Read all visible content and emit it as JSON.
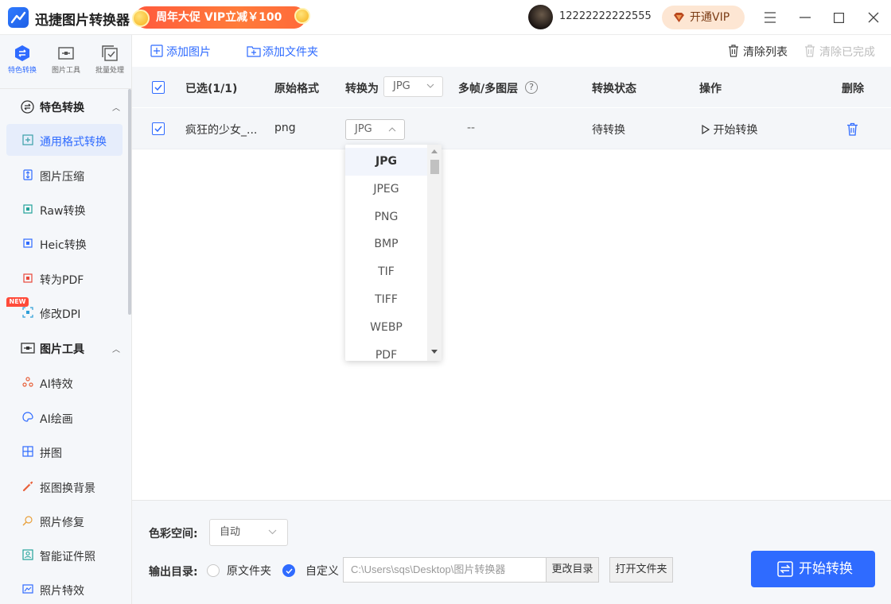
{
  "app": {
    "title": "迅捷图片转换器",
    "promo": "周年大促 VIP立减￥100",
    "user_phone": "12222222222555",
    "vip_label": "开通VIP"
  },
  "sidebar": {
    "tabs": [
      {
        "label": "特色转换",
        "icon": "special-convert-icon",
        "active": true
      },
      {
        "label": "图片工具",
        "icon": "image-tools-icon",
        "active": false
      },
      {
        "label": "批量处理",
        "icon": "batch-process-icon",
        "active": false
      }
    ],
    "groups": [
      {
        "label": "特色转换",
        "icon": "special-convert-icon",
        "items": [
          {
            "label": "通用格式转换",
            "icon": "format-convert-icon",
            "active": true
          },
          {
            "label": "图片压缩",
            "icon": "compress-icon"
          },
          {
            "label": "Raw转换",
            "icon": "raw-icon"
          },
          {
            "label": "Heic转换",
            "icon": "heic-icon"
          },
          {
            "label": "转为PDF",
            "icon": "pdf-icon"
          },
          {
            "label": "修改DPI",
            "icon": "dpi-icon",
            "badge": "NEW"
          }
        ]
      },
      {
        "label": "图片工具",
        "icon": "image-tools-icon",
        "items": [
          {
            "label": "AI特效",
            "icon": "ai-effect-icon"
          },
          {
            "label": "AI绘画",
            "icon": "ai-paint-icon"
          },
          {
            "label": "拼图",
            "icon": "collage-icon"
          },
          {
            "label": "抠图换背景",
            "icon": "cutout-icon"
          },
          {
            "label": "照片修复",
            "icon": "photo-repair-icon"
          },
          {
            "label": "智能证件照",
            "icon": "id-photo-icon"
          },
          {
            "label": "照片特效",
            "icon": "photo-effect-icon"
          }
        ]
      }
    ]
  },
  "toolbar": {
    "add_image": "添加图片",
    "add_folder": "添加文件夹",
    "clear_list": "清除列表",
    "clear_done": "清除已完成"
  },
  "table": {
    "headers": {
      "selected": "已选(1/1)",
      "original_format": "原始格式",
      "convert_to": "转换为",
      "convert_to_value": "JPG",
      "multi_frame": "多帧/多图层",
      "help": "?",
      "status": "转换状态",
      "action": "操作",
      "delete": "删除"
    },
    "rows": [
      {
        "name": "疯狂的少女_...",
        "format": "png",
        "target": "JPG",
        "multi_frame": "--",
        "status": "待转换",
        "action": "开始转换"
      }
    ]
  },
  "format_dropdown": {
    "options": [
      "JPG",
      "JPEG",
      "PNG",
      "BMP",
      "TIF",
      "TIFF",
      "WEBP",
      "PDF"
    ],
    "selected": "JPG"
  },
  "bottom": {
    "color_space_label": "色彩空间:",
    "color_space_value": "自动",
    "output_label": "输出目录:",
    "opt_original": "原文件夹",
    "opt_custom": "自定义",
    "path": "C:\\Users\\sqs\\Desktop\\图片转换器",
    "change_dir": "更改目录",
    "open_folder": "打开文件夹",
    "start": "开始转换"
  },
  "colors": {
    "accent": "#2f6bff",
    "promo": "#ff5a3c",
    "new_badge": "#ff4b3a"
  }
}
